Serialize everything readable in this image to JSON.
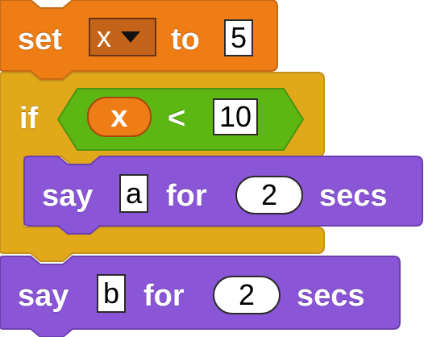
{
  "colors": {
    "variables": "#ee7d16",
    "variables_dark": "#c76a12",
    "variables_dropdown": "#c4631a",
    "control": "#e1a91a",
    "control_dark": "#c5911a",
    "operators": "#5cb712",
    "operators_dark": "#4a9410",
    "looks": "#8a55d7",
    "looks_dark": "#6d40b0"
  },
  "set_block": {
    "set_label": "set",
    "variable": "x",
    "to_label": "to",
    "value": "5"
  },
  "if_block": {
    "if_label": "if",
    "condition": {
      "left_var": "x",
      "operator": "<",
      "right_value": "10"
    },
    "say_block": {
      "say_label": "say",
      "message": "a",
      "for_label": "for",
      "secs_value": "2",
      "secs_label": "secs"
    }
  },
  "say_block": {
    "say_label": "say",
    "message": "b",
    "for_label": "for",
    "secs_value": "2",
    "secs_label": "secs"
  }
}
